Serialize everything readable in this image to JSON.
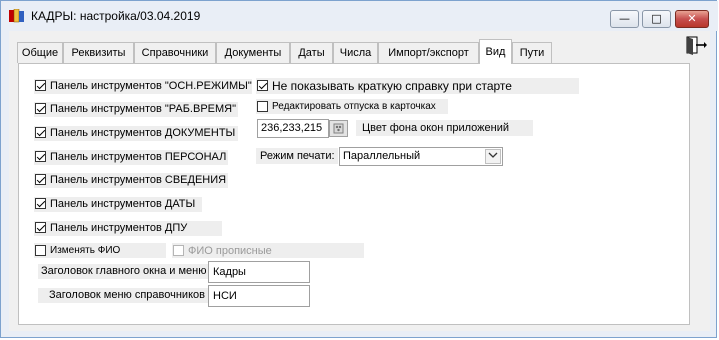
{
  "window": {
    "title": "КАДРЫ: настройка/03.04.2019",
    "minimize_glyph": "—",
    "maximize_glyph": "□",
    "close_glyph": "✕"
  },
  "tabs": [
    {
      "label": "Общие"
    },
    {
      "label": "Реквизиты"
    },
    {
      "label": "Справочники"
    },
    {
      "label": "Документы"
    },
    {
      "label": "Даты"
    },
    {
      "label": "Числа"
    },
    {
      "label": "Импорт/экспорт"
    },
    {
      "label": "Вид",
      "active": true
    },
    {
      "label": "Пути"
    }
  ],
  "left_checkboxes": [
    {
      "label": "Панель инструментов \"ОСН.РЕЖИМЫ\"",
      "checked": true
    },
    {
      "label": "Панель инструментов \"РАБ.ВРЕМЯ\"",
      "checked": true
    },
    {
      "label": "Панель инструментов ДОКУМЕНТЫ",
      "checked": true
    },
    {
      "label": "Панель инструментов ПЕРСОНАЛ",
      "checked": true
    },
    {
      "label": "Панель инструментов СВЕДЕНИЯ",
      "checked": true
    },
    {
      "label": "Панель инструментов ДАТЫ",
      "checked": true
    },
    {
      "label": "Панель инструментов ДПУ",
      "checked": true
    }
  ],
  "change_fio": {
    "label": "Изменять ФИО",
    "checked": false
  },
  "fio_uppercase": {
    "label": "ФИО прописные",
    "checked": false,
    "disabled": true
  },
  "no_help_at_start": {
    "label": "Не показывать краткую справку при старте",
    "checked": true
  },
  "edit_vacations": {
    "label": "Редактировать отпуска в карточках",
    "checked": false
  },
  "bg_color": {
    "value": "236,233,215",
    "label": "Цвет фона окон приложений"
  },
  "print_mode": {
    "label": "Режим печати:",
    "value": "Параллельный"
  },
  "main_title": {
    "label": "Заголовок главного окна и меню",
    "value": "Кадры"
  },
  "ref_menu_title": {
    "label": "Заголовок меню справочников",
    "value": "НСИ"
  },
  "colors": {
    "accent_blue": "#7da2ce",
    "close_red": "#c75050"
  }
}
